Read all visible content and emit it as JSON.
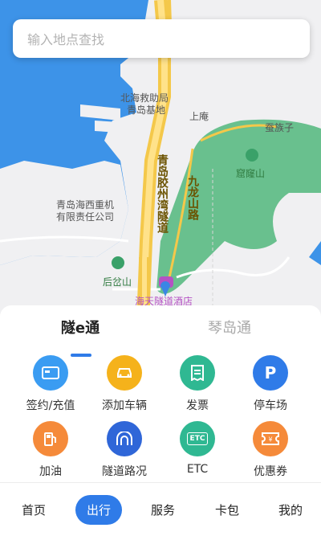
{
  "search": {
    "placeholder": "输入地点查找"
  },
  "map": {
    "labels": {
      "rescue_bureau_1": "北海救助局",
      "rescue_bureau_2": "青岛基地",
      "shangyan": "上庵",
      "canzuzi": "蚕族子",
      "kulong_mountain": "窟窿山",
      "jiulong_road": "九龙山路",
      "tunnel_road": "青岛胶州湾隧道",
      "heavy_machinery_1": "青岛海西重机",
      "heavy_machinery_2": "有限责任公司",
      "houcha_mountain": "后岔山",
      "hotel": "海天隧道酒店"
    }
  },
  "tabs": [
    {
      "label": "隧e通",
      "active": true
    },
    {
      "label": "琴岛通",
      "active": false
    }
  ],
  "services": [
    {
      "label": "签约/充值",
      "icon": "card-icon",
      "color": "#3a9cf2"
    },
    {
      "label": "添加车辆",
      "icon": "car-icon",
      "color": "#f5b21b"
    },
    {
      "label": "发票",
      "icon": "receipt-icon",
      "color": "#2fb892"
    },
    {
      "label": "停车场",
      "icon": "parking-icon",
      "color": "#2f7be8"
    },
    {
      "label": "加油",
      "icon": "fuel-icon",
      "color": "#f58a3a"
    },
    {
      "label": "隧道路况",
      "icon": "tunnel-icon",
      "color": "#2f66d8"
    },
    {
      "label": "ETC",
      "icon": "etc-icon",
      "color": "#2fb892"
    },
    {
      "label": "优惠券",
      "icon": "coupon-icon",
      "color": "#f58a3a"
    }
  ],
  "nav": [
    {
      "label": "首页",
      "active": false
    },
    {
      "label": "出行",
      "active": true
    },
    {
      "label": "服务",
      "active": false
    },
    {
      "label": "卡包",
      "active": false
    },
    {
      "label": "我的",
      "active": false
    }
  ]
}
